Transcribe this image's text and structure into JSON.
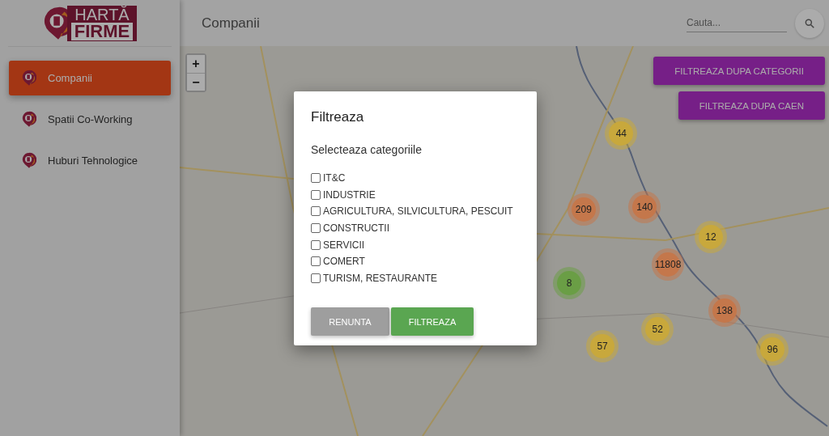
{
  "logo": {
    "line_1": "HARTĂ",
    "line_2": "FIRME"
  },
  "sidebar": {
    "items": [
      {
        "label": "Companii",
        "selected": true
      },
      {
        "label": "Spatii Co-Working",
        "selected": false
      },
      {
        "label": "Huburi Tehnologice",
        "selected": false
      }
    ]
  },
  "header": {
    "title": "Companii",
    "search": {
      "placeholder": "Cauta..."
    }
  },
  "map": {
    "zoom_in": "+",
    "zoom_out": "−",
    "filter_buttons": [
      "FILTREAZA DUPA CATEGORII",
      "FILTREAZA DUPA CAEN"
    ],
    "clusters": [
      {
        "count": "44",
        "color": "#c8a83c"
      },
      {
        "count": "209",
        "color": "#c4774b"
      },
      {
        "count": "140",
        "color": "#c4774b"
      },
      {
        "count": "12",
        "color": "#c8a83c"
      },
      {
        "count": "11808",
        "color": "#c4774b"
      },
      {
        "count": "8",
        "color": "#6a9e45"
      },
      {
        "count": "138",
        "color": "#c4774b"
      },
      {
        "count": "52",
        "color": "#c8a83c"
      },
      {
        "count": "57",
        "color": "#c8a83c"
      },
      {
        "count": "96",
        "color": "#c8a83c"
      }
    ]
  },
  "dialog": {
    "title": "Filtreaza",
    "subtitle": "Selecteaza categoriile",
    "categories": [
      {
        "label": "IT&C",
        "checked": false
      },
      {
        "label": "INDUSTRIE",
        "checked": false
      },
      {
        "label": "AGRICULTURA, SILVICULTURA, PESCUIT",
        "checked": false
      },
      {
        "label": "CONSTRUCTII",
        "checked": false
      },
      {
        "label": "SERVICII",
        "checked": false
      },
      {
        "label": "COMERT",
        "checked": false
      },
      {
        "label": "TURISM, RESTAURANTE",
        "checked": false
      }
    ],
    "buttons": [
      {
        "label": "RENUNTA",
        "kind": "cancel"
      },
      {
        "label": "FILTREAZA",
        "kind": "confirm"
      }
    ]
  }
}
